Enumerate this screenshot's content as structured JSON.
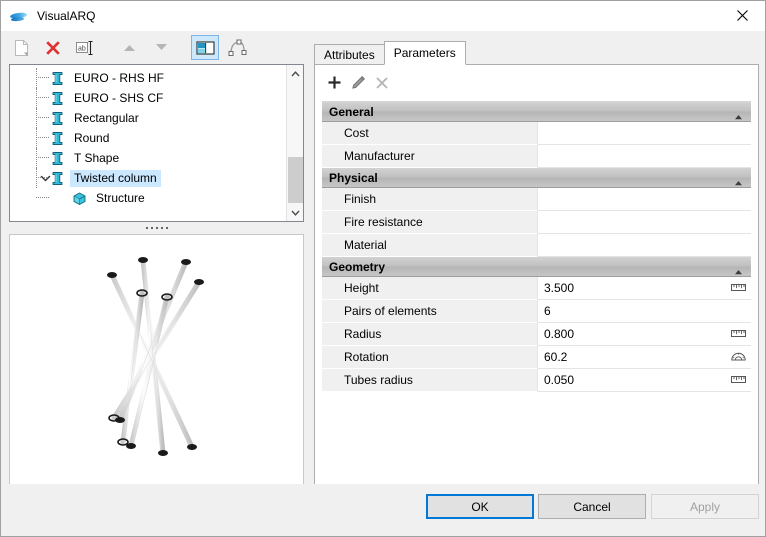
{
  "window": {
    "title": "VisualARQ",
    "logo_icon": "visualarq-logo-icon",
    "close_icon": "close-icon"
  },
  "toolbar": {
    "buttons": [
      {
        "name": "new-style-button",
        "icon": "new-document-icon",
        "enabled": false,
        "active": false
      },
      {
        "name": "delete-style-button",
        "icon": "red-x-delete-icon",
        "enabled": true,
        "active": false
      },
      {
        "name": "rename-style-button",
        "icon": "rename-text-icon",
        "enabled": true,
        "active": false
      },
      {
        "name": "move-up-button",
        "icon": "arrow-up-icon",
        "enabled": false,
        "active": false
      },
      {
        "name": "move-down-button",
        "icon": "arrow-down-icon",
        "enabled": false,
        "active": false
      },
      {
        "name": "toggle-preview-button",
        "icon": "split-view-icon",
        "enabled": true,
        "active": true
      },
      {
        "name": "profile-curve-button",
        "icon": "profile-curve-icon",
        "enabled": false,
        "active": false
      }
    ]
  },
  "tree": {
    "items": [
      {
        "label": "EURO - RHS HF",
        "icon": "column-icon",
        "level": 1,
        "selected": false,
        "expander": ""
      },
      {
        "label": "EURO - SHS CF",
        "icon": "column-icon",
        "level": 1,
        "selected": false,
        "expander": ""
      },
      {
        "label": "Rectangular",
        "icon": "column-icon",
        "level": 1,
        "selected": false,
        "expander": ""
      },
      {
        "label": "Round",
        "icon": "column-icon",
        "level": 1,
        "selected": false,
        "expander": ""
      },
      {
        "label": "T Shape",
        "icon": "column-icon",
        "level": 1,
        "selected": false,
        "expander": ""
      },
      {
        "label": "Twisted column",
        "icon": "column-icon",
        "level": 1,
        "selected": true,
        "expander": "expanded"
      },
      {
        "label": "Structure",
        "icon": "cube-icon",
        "level": 2,
        "selected": false,
        "expander": ""
      }
    ],
    "scrollbar": {
      "up_icon": "chevron-up-icon",
      "down_icon": "chevron-down-icon"
    }
  },
  "splitter": {
    "name": "panel-splitter"
  },
  "preview": {
    "name": "style-3d-preview",
    "description": "Twisted column 3D preview"
  },
  "tabs": [
    {
      "label": "Attributes",
      "active": false
    },
    {
      "label": "Parameters",
      "active": true
    }
  ],
  "panel_toolbar": [
    {
      "name": "add-parameter-button",
      "icon": "plus-icon",
      "enabled": true
    },
    {
      "name": "edit-parameter-button",
      "icon": "pencil-icon",
      "enabled": true
    },
    {
      "name": "delete-parameter-button",
      "icon": "x-icon",
      "enabled": false
    }
  ],
  "parameter_groups": [
    {
      "title": "General",
      "collapse_icon": "chevron-up-icon",
      "rows": [
        {
          "name": "Cost",
          "value": "",
          "unit_icon": ""
        },
        {
          "name": "Manufacturer",
          "value": "",
          "unit_icon": ""
        }
      ]
    },
    {
      "title": "Physical",
      "collapse_icon": "chevron-up-icon",
      "rows": [
        {
          "name": "Finish",
          "value": "",
          "unit_icon": ""
        },
        {
          "name": "Fire resistance",
          "value": "",
          "unit_icon": ""
        },
        {
          "name": "Material",
          "value": "",
          "unit_icon": ""
        }
      ]
    },
    {
      "title": "Geometry",
      "collapse_icon": "chevron-up-icon",
      "rows": [
        {
          "name": "Height",
          "value": "3.500",
          "unit_icon": "ruler-icon"
        },
        {
          "name": "Pairs of elements",
          "value": "6",
          "unit_icon": ""
        },
        {
          "name": "Radius",
          "value": "0.800",
          "unit_icon": "ruler-icon"
        },
        {
          "name": "Rotation",
          "value": "60.2",
          "unit_icon": "protractor-icon"
        },
        {
          "name": "Tubes radius",
          "value": "0.050",
          "unit_icon": "ruler-icon"
        }
      ]
    }
  ],
  "dialog_buttons": {
    "ok": "OK",
    "cancel": "Cancel",
    "apply": "Apply",
    "apply_enabled": false
  },
  "colors": {
    "accent": "#0078d7",
    "selection": "#cce8ff",
    "toolbar_active": "#cde8fb",
    "icon_teal": "#31b8d8",
    "delete_red": "#e03131",
    "group_header": "#c0c0c0"
  }
}
